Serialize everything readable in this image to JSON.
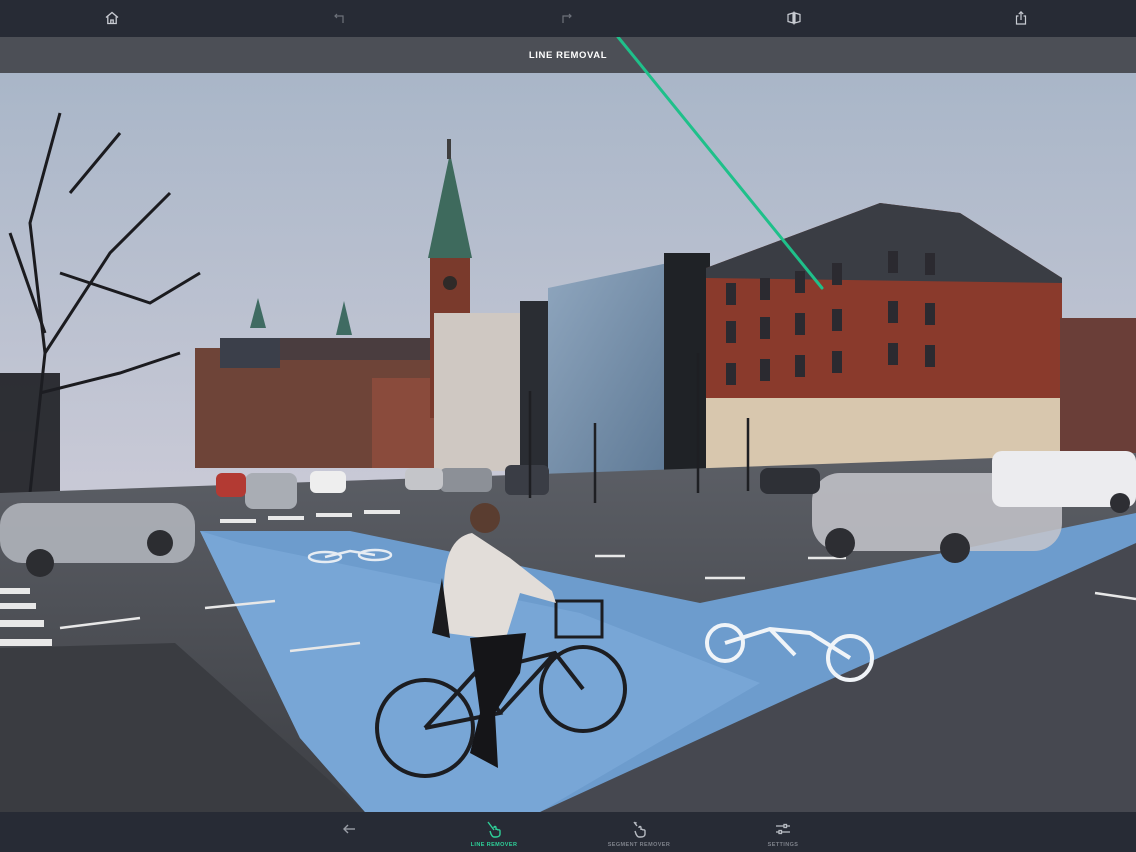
{
  "topbar": {
    "home_icon": "home-icon",
    "undo_icon": "undo-icon",
    "redo_icon": "redo-icon",
    "compare_icon": "compare-icon",
    "share_icon": "share-icon"
  },
  "mode": {
    "title": "LINE REMOVAL"
  },
  "photo": {
    "description_icon": "photo-canvas"
  },
  "bottombar": {
    "back_icon": "back-arrow-icon",
    "items": [
      {
        "label": "LINE REMOVER",
        "icon": "line-remover-icon",
        "active": true
      },
      {
        "label": "SEGMENT REMOVER",
        "icon": "segment-remover-icon",
        "active": false
      },
      {
        "label": "SETTINGS",
        "icon": "settings-sliders-icon",
        "active": false
      }
    ]
  },
  "colors": {
    "toolbar_bg": "#272b35",
    "modebar_bg": "#4c4f56",
    "accent": "#2ed199",
    "inactive": "#7d818a"
  }
}
